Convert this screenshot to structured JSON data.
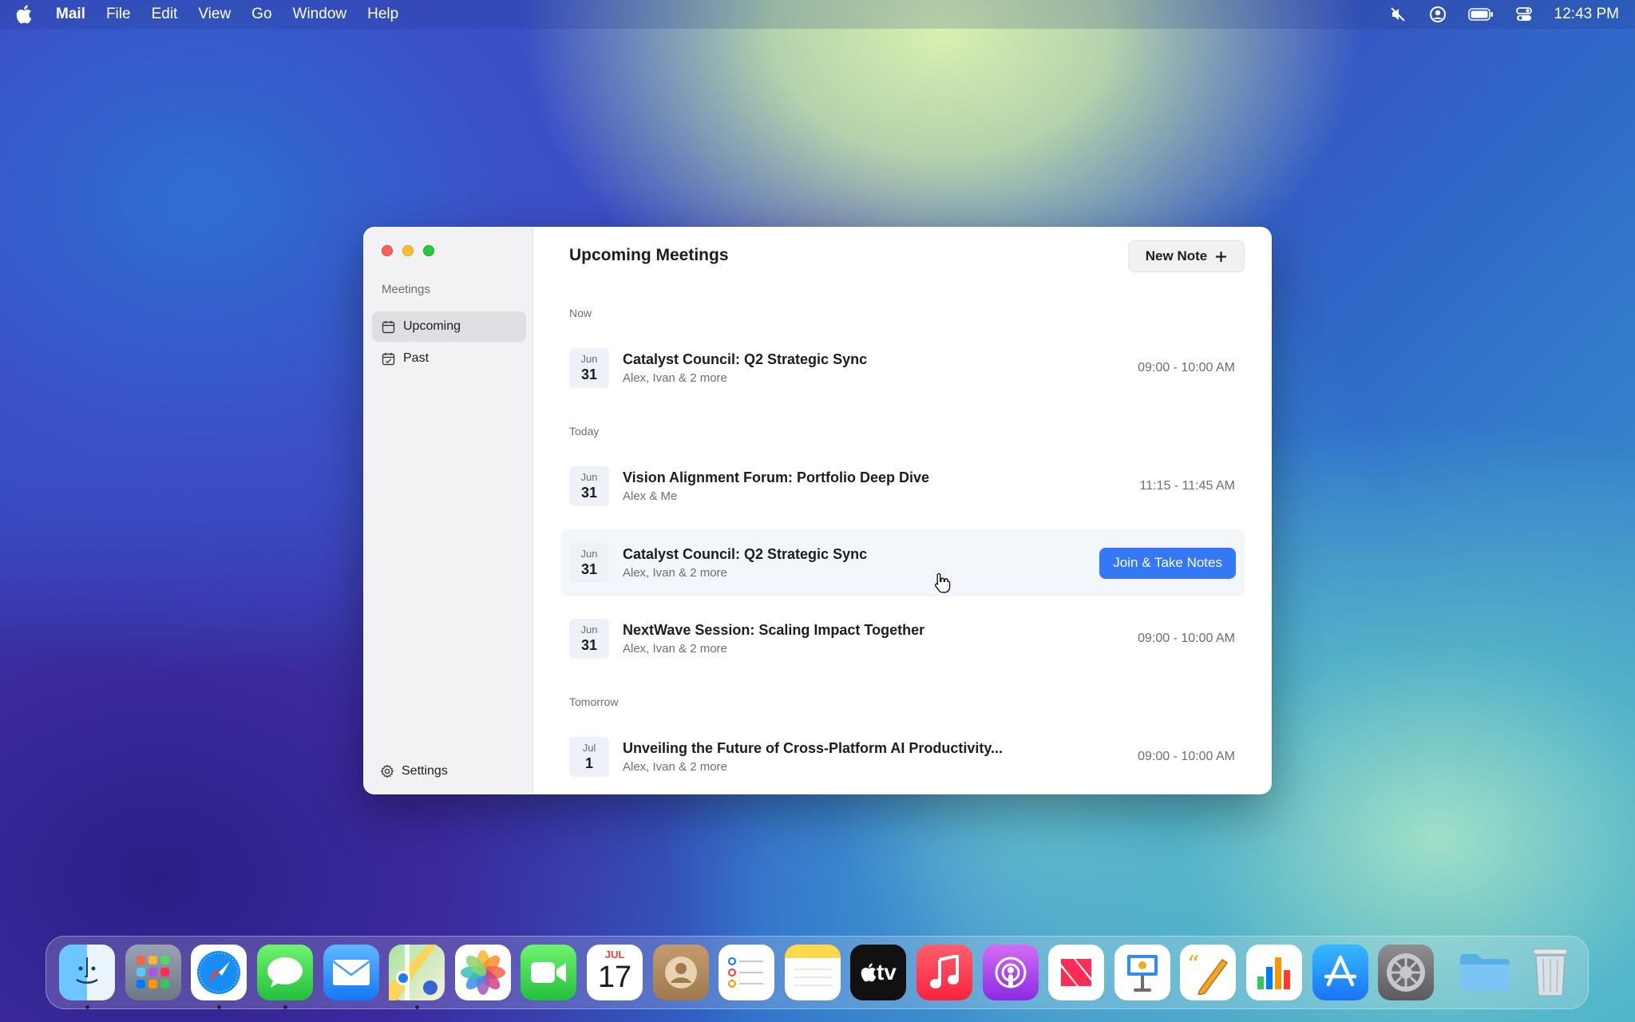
{
  "menubar": {
    "app_name": "Mail",
    "items": [
      "File",
      "Edit",
      "View",
      "Go",
      "Window",
      "Help"
    ],
    "clock": "12:43 PM"
  },
  "sidebar": {
    "heading": "Meetings",
    "items": [
      {
        "label": "Upcoming",
        "icon": "calendar-icon",
        "active": true
      },
      {
        "label": "Past",
        "icon": "calendar-check-icon",
        "active": false
      }
    ],
    "settings_label": "Settings"
  },
  "main": {
    "title": "Upcoming Meetings",
    "new_note_label": "New Note",
    "sections": [
      {
        "label": "Now"
      },
      {
        "label": "Today"
      },
      {
        "label": "Tomorrow"
      }
    ],
    "meetings": [
      {
        "month": "Jun",
        "day": "31",
        "title": "Catalyst Council: Q2 Strategic Sync",
        "people": "Alex, Ivan & 2 more",
        "time": "09:00 - 10:00 AM"
      },
      {
        "month": "Jun",
        "day": "31",
        "title": "Vision Alignment Forum: Portfolio Deep Dive",
        "people": "Alex & Me",
        "time": "11:15 - 11:45 AM"
      },
      {
        "month": "Jun",
        "day": "31",
        "title": "Catalyst Council: Q2 Strategic Sync",
        "people": "Alex, Ivan & 2 more",
        "action": "Join & Take Notes"
      },
      {
        "month": "Jun",
        "day": "31",
        "title": "NextWave Session: Scaling Impact Together",
        "people": "Alex, Ivan & 2 more",
        "time": "09:00 - 10:00 AM"
      },
      {
        "month": "Jul",
        "day": "1",
        "title": "Unveiling the Future of Cross-Platform AI Productivity...",
        "people": "Alex, Ivan & 2 more",
        "time": "09:00 - 10:00 AM"
      }
    ]
  },
  "dock": {
    "calendar_month": "JUL",
    "calendar_day": "17",
    "tv_label": "tv"
  }
}
